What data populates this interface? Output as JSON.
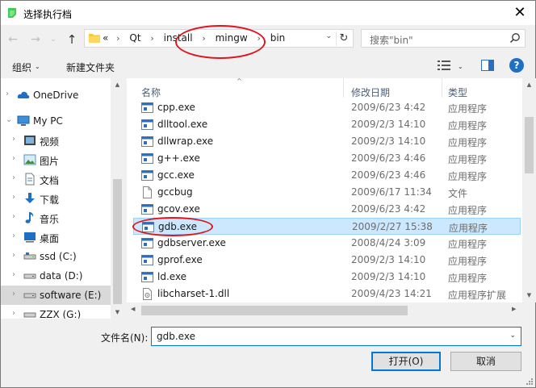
{
  "window": {
    "title": "选择执行档",
    "close_glyph": "✕"
  },
  "nav": {
    "back": "←",
    "forward": "→",
    "dropdown": "⌄",
    "up": "↑"
  },
  "address": {
    "overflow": "«",
    "crumbs": [
      "Qt",
      "install",
      "mingw",
      "bin"
    ],
    "separator": "›",
    "refresh": "↻"
  },
  "search": {
    "placeholder": "搜索\"bin\""
  },
  "toolbar": {
    "organize": "组织",
    "new_folder": "新建文件夹",
    "help": "?"
  },
  "sidebar": {
    "items": [
      {
        "label": "OneDrive",
        "icon": "cloud-icon"
      },
      {
        "label": "My PC",
        "icon": "computer-icon"
      },
      {
        "label": "视频",
        "icon": "video-icon"
      },
      {
        "label": "图片",
        "icon": "picture-icon"
      },
      {
        "label": "文档",
        "icon": "document-icon"
      },
      {
        "label": "下载",
        "icon": "download-icon"
      },
      {
        "label": "音乐",
        "icon": "music-icon"
      },
      {
        "label": "桌面",
        "icon": "desktop-icon"
      },
      {
        "label": "ssd (C:)",
        "icon": "drive-icon"
      },
      {
        "label": "data (D:)",
        "icon": "drive-icon"
      },
      {
        "label": "software (E:)",
        "icon": "drive-icon",
        "selected": true
      },
      {
        "label": "ZZX (G:)",
        "icon": "drive-icon"
      }
    ]
  },
  "columns": {
    "name": "名称",
    "modified": "修改日期",
    "type": "类型"
  },
  "files": [
    {
      "name": "cpp.exe",
      "date": "2009/6/23 4:42",
      "type": "应用程序",
      "icon": "exe-icon"
    },
    {
      "name": "dlltool.exe",
      "date": "2009/2/3 14:10",
      "type": "应用程序",
      "icon": "exe-icon"
    },
    {
      "name": "dllwrap.exe",
      "date": "2009/2/3 14:10",
      "type": "应用程序",
      "icon": "exe-icon"
    },
    {
      "name": "g++.exe",
      "date": "2009/6/23 4:46",
      "type": "应用程序",
      "icon": "exe-icon"
    },
    {
      "name": "gcc.exe",
      "date": "2009/6/23 4:46",
      "type": "应用程序",
      "icon": "exe-icon"
    },
    {
      "name": "gccbug",
      "date": "2009/6/17 11:34",
      "type": "文件",
      "icon": "file-icon"
    },
    {
      "name": "gcov.exe",
      "date": "2009/6/23 4:42",
      "type": "应用程序",
      "icon": "exe-icon"
    },
    {
      "name": "gdb.exe",
      "date": "2009/2/27 15:38",
      "type": "应用程序",
      "icon": "exe-icon",
      "selected": true
    },
    {
      "name": "gdbserver.exe",
      "date": "2008/4/24 3:09",
      "type": "应用程序",
      "icon": "exe-icon"
    },
    {
      "name": "gprof.exe",
      "date": "2009/2/3 14:10",
      "type": "应用程序",
      "icon": "exe-icon"
    },
    {
      "name": "ld.exe",
      "date": "2009/2/3 14:10",
      "type": "应用程序",
      "icon": "exe-icon"
    },
    {
      "name": "libcharset-1.dll",
      "date": "2009/4/23 14:21",
      "type": "应用程序扩展",
      "icon": "dll-icon"
    }
  ],
  "bottom": {
    "filename_label": "文件名(N):",
    "filename_value": "gdb.exe",
    "open_button": "打开(O)",
    "cancel_button": "取消"
  },
  "colors": {
    "accent": "#0078d7",
    "selection": "#cce8ff",
    "annotation": "#e0141e"
  }
}
